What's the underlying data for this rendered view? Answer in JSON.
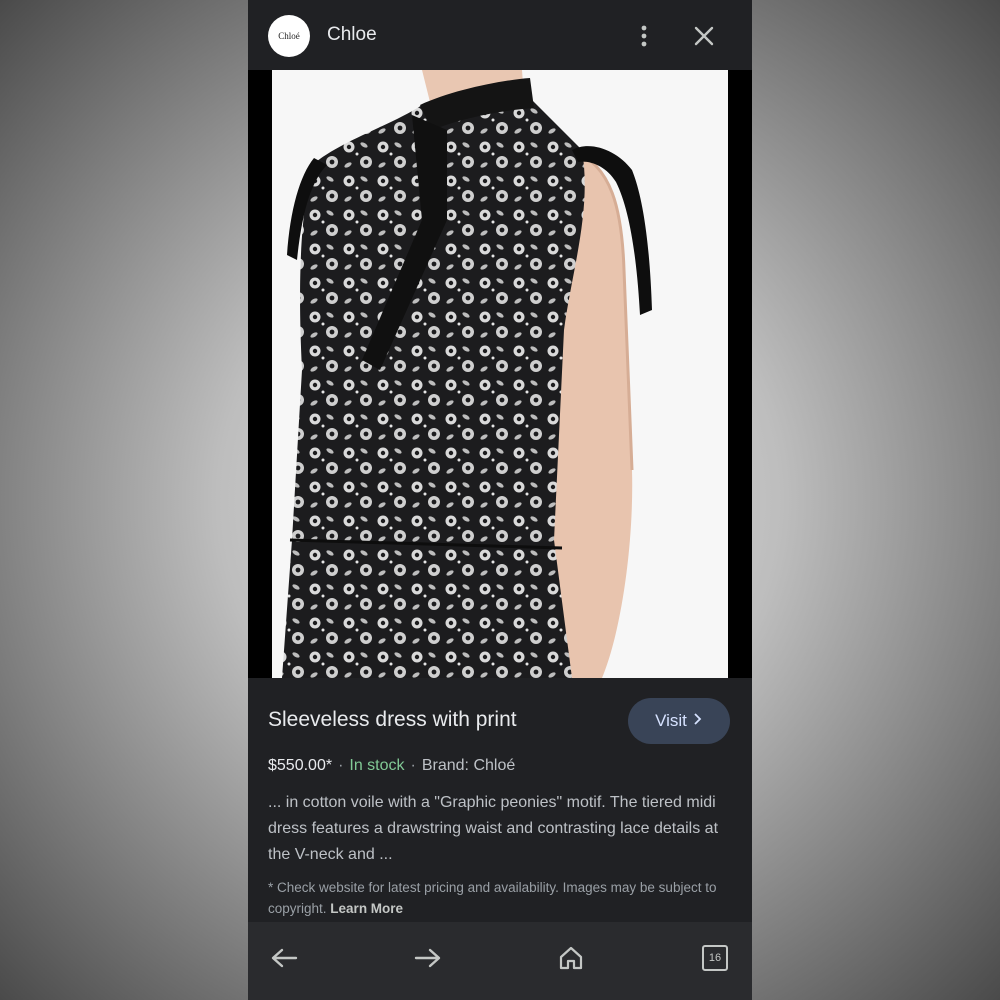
{
  "header": {
    "logo_text": "Chloé",
    "site_name": "Chloe"
  },
  "product": {
    "title": "Sleeveless dress with print",
    "visit_label": "Visit",
    "price": "$550.00*",
    "stock": "In stock",
    "brand": "Brand: Chloé",
    "description": "... in cotton voile with a \"Graphic peonies\" motif. The tiered midi dress features a drawstring waist and contrasting lace details at the V-neck and ...",
    "disclaimer": "* Check website for latest pricing and availability. Images may be subject to copyright.",
    "learn_more": "Learn More"
  },
  "nav": {
    "tab_count": "16"
  },
  "icons": [
    "more-vert-icon",
    "close-icon",
    "chevron-right-icon",
    "back-arrow-icon",
    "forward-arrow-icon",
    "home-icon",
    "tabs-icon"
  ],
  "colors": {
    "background": "#202124",
    "visit_button": "#394457",
    "in_stock": "#81c995"
  }
}
